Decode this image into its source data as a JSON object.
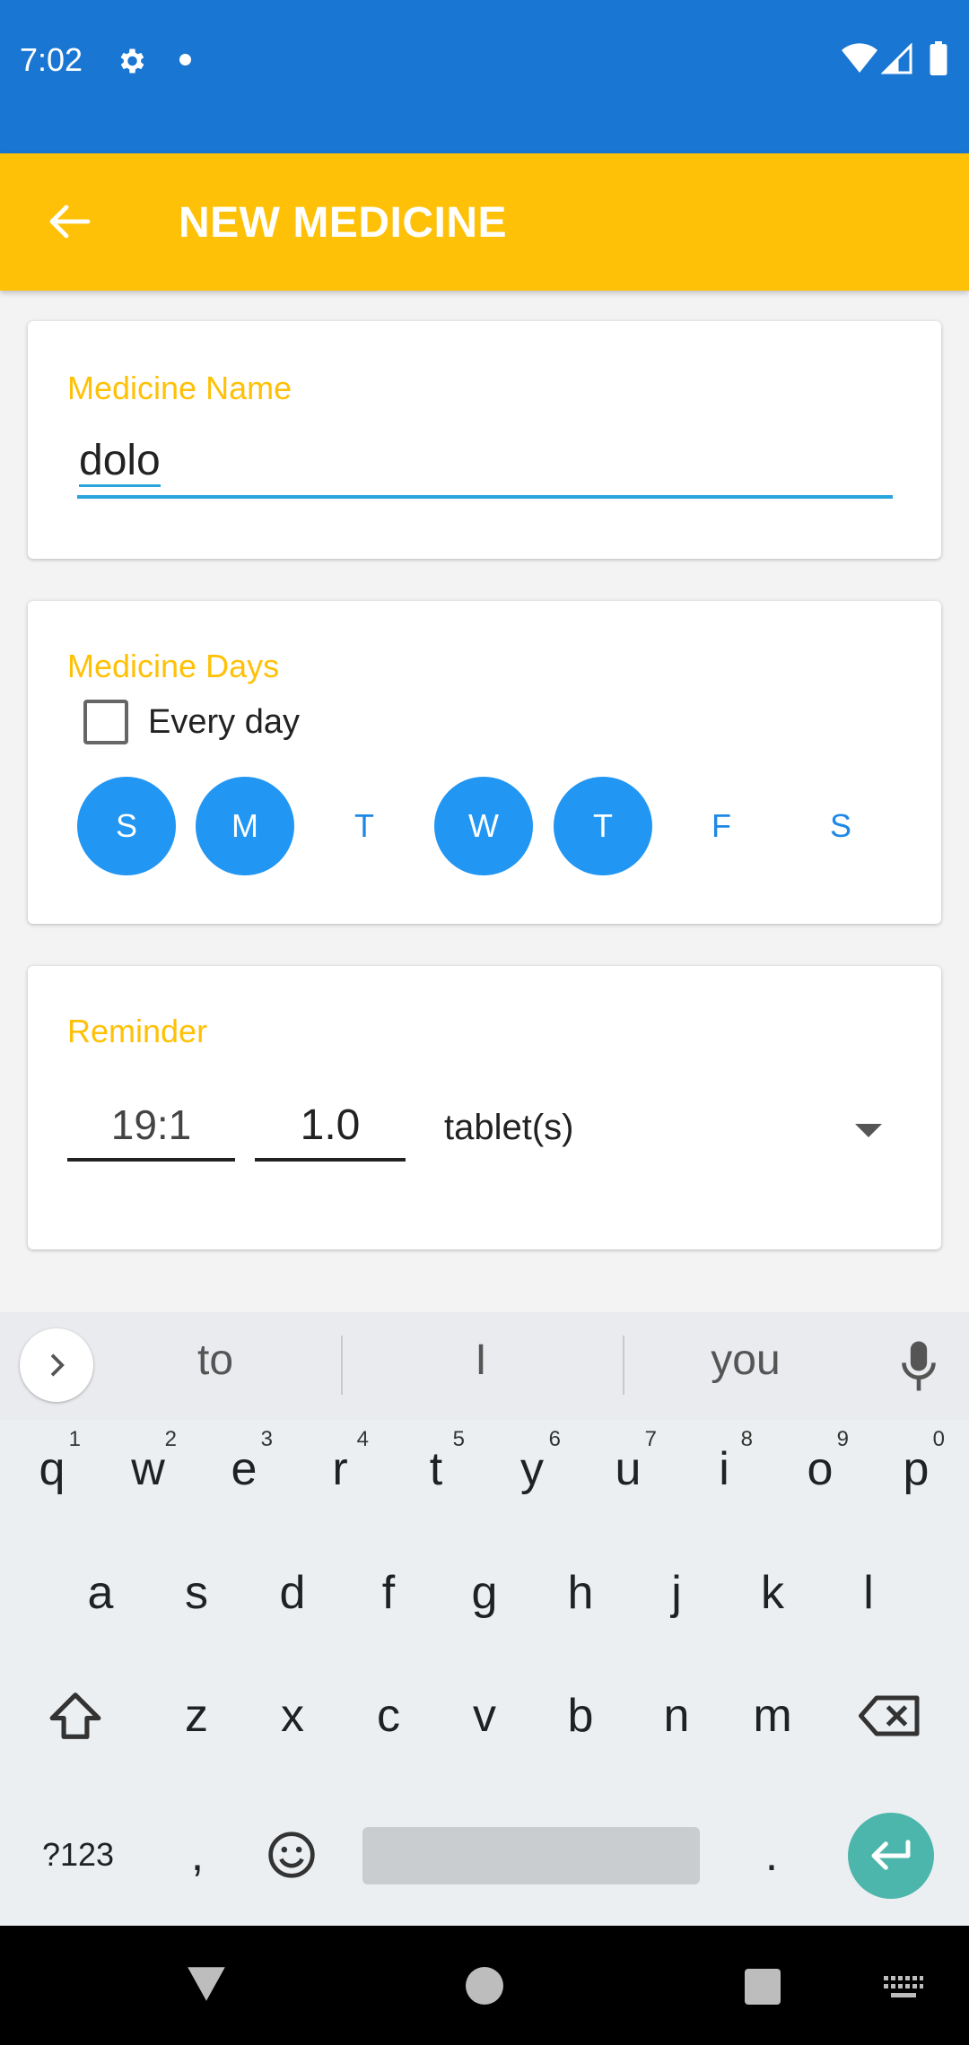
{
  "status_bar": {
    "time": "7:02"
  },
  "app_bar": {
    "title": "NEW MEDICINE"
  },
  "name_card": {
    "label": "Medicine Name",
    "value": "dolo"
  },
  "days_card": {
    "label": "Medicine Days",
    "every_day_label": "Every day",
    "every_day_checked": false,
    "days": [
      {
        "letter": "S",
        "selected": true
      },
      {
        "letter": "M",
        "selected": true
      },
      {
        "letter": "T",
        "selected": false
      },
      {
        "letter": "W",
        "selected": true
      },
      {
        "letter": "T",
        "selected": true
      },
      {
        "letter": "F",
        "selected": false
      },
      {
        "letter": "S",
        "selected": false
      }
    ]
  },
  "reminder_card": {
    "label": "Reminder",
    "time": "19:1",
    "dose": "1.0",
    "unit": "tablet(s)"
  },
  "keyboard": {
    "suggestions": [
      "to",
      "I",
      "you"
    ],
    "row1": [
      "q",
      "w",
      "e",
      "r",
      "t",
      "y",
      "u",
      "i",
      "o",
      "p"
    ],
    "row1_hints": [
      "1",
      "2",
      "3",
      "4",
      "5",
      "6",
      "7",
      "8",
      "9",
      "0"
    ],
    "row2": [
      "a",
      "s",
      "d",
      "f",
      "g",
      "h",
      "j",
      "k",
      "l"
    ],
    "row3": [
      "z",
      "x",
      "c",
      "v",
      "b",
      "n",
      "m"
    ],
    "symbols_label": "?123",
    "comma": ",",
    "period": "."
  },
  "colors": {
    "status_bar": "#1976d2",
    "app_bar": "#ffc107",
    "accent_label": "#ffc107",
    "day_selected": "#2196f3",
    "input_underline": "#29a4dd",
    "enter_key": "#4db6ac"
  }
}
